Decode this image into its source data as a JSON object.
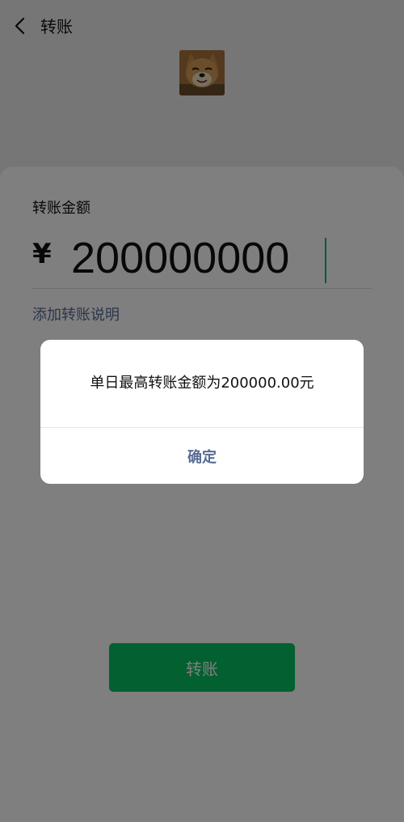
{
  "header": {
    "title": "转账",
    "back_icon": "chevron-left-icon"
  },
  "payee": {
    "avatar_icon": "shiba-dog-avatar",
    "name": ""
  },
  "form": {
    "amount_label": "转账金额",
    "currency_symbol": "¥",
    "amount": "200000000",
    "add_note_link": "添加转账说明"
  },
  "transfer_button_label": "转账",
  "dialog": {
    "message": "单日最高转账金额为200000.00元",
    "confirm_label": "确定"
  },
  "colors": {
    "accent_green": "#07c160",
    "link_blue": "#576b95",
    "page_bg": "#ededed"
  }
}
